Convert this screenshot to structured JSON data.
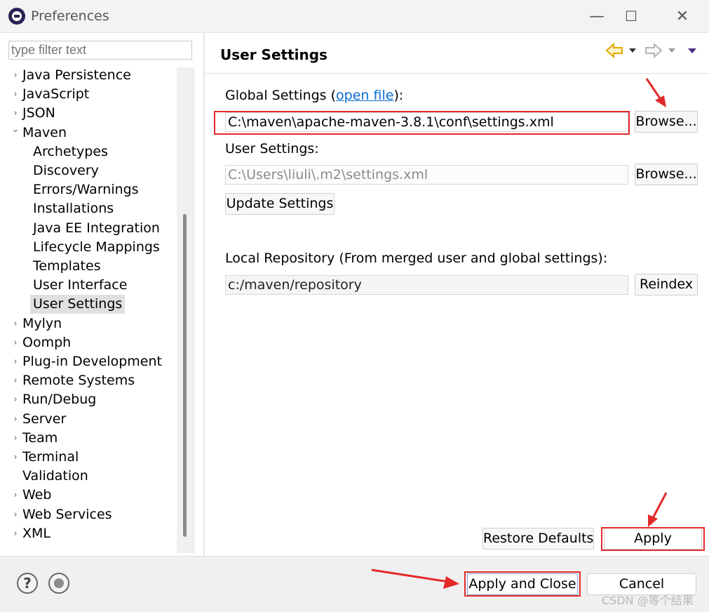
{
  "window": {
    "title": "Preferences",
    "minimize": "—",
    "maximize": "☐",
    "close": "✕"
  },
  "filter": {
    "placeholder": "type filter text"
  },
  "tree": {
    "items": [
      {
        "label": "Java Persistence",
        "expandable": true,
        "expanded": false,
        "indent": 0,
        "selected": false
      },
      {
        "label": "JavaScript",
        "expandable": true,
        "expanded": false,
        "indent": 0,
        "selected": false
      },
      {
        "label": "JSON",
        "expandable": true,
        "expanded": false,
        "indent": 0,
        "selected": false
      },
      {
        "label": "Maven",
        "expandable": true,
        "expanded": true,
        "indent": 0,
        "selected": false
      },
      {
        "label": "Archetypes",
        "expandable": false,
        "expanded": false,
        "indent": 1,
        "selected": false
      },
      {
        "label": "Discovery",
        "expandable": false,
        "expanded": false,
        "indent": 1,
        "selected": false
      },
      {
        "label": "Errors/Warnings",
        "expandable": false,
        "expanded": false,
        "indent": 1,
        "selected": false
      },
      {
        "label": "Installations",
        "expandable": false,
        "expanded": false,
        "indent": 1,
        "selected": false
      },
      {
        "label": "Java EE Integration",
        "expandable": false,
        "expanded": false,
        "indent": 1,
        "selected": false
      },
      {
        "label": "Lifecycle Mappings",
        "expandable": false,
        "expanded": false,
        "indent": 1,
        "selected": false
      },
      {
        "label": "Templates",
        "expandable": false,
        "expanded": false,
        "indent": 1,
        "selected": false
      },
      {
        "label": "User Interface",
        "expandable": false,
        "expanded": false,
        "indent": 1,
        "selected": false
      },
      {
        "label": "User Settings",
        "expandable": false,
        "expanded": false,
        "indent": 1,
        "selected": true
      },
      {
        "label": "Mylyn",
        "expandable": true,
        "expanded": false,
        "indent": 0,
        "selected": false
      },
      {
        "label": "Oomph",
        "expandable": true,
        "expanded": false,
        "indent": 0,
        "selected": false
      },
      {
        "label": "Plug-in Development",
        "expandable": true,
        "expanded": false,
        "indent": 0,
        "selected": false
      },
      {
        "label": "Remote Systems",
        "expandable": true,
        "expanded": false,
        "indent": 0,
        "selected": false
      },
      {
        "label": "Run/Debug",
        "expandable": true,
        "expanded": false,
        "indent": 0,
        "selected": false
      },
      {
        "label": "Server",
        "expandable": true,
        "expanded": false,
        "indent": 0,
        "selected": false
      },
      {
        "label": "Team",
        "expandable": true,
        "expanded": false,
        "indent": 0,
        "selected": false
      },
      {
        "label": "Terminal",
        "expandable": true,
        "expanded": false,
        "indent": 0,
        "selected": false
      },
      {
        "label": "Validation",
        "expandable": false,
        "expanded": false,
        "indent": 0,
        "selected": false
      },
      {
        "label": "Web",
        "expandable": true,
        "expanded": false,
        "indent": 0,
        "selected": false
      },
      {
        "label": "Web Services",
        "expandable": true,
        "expanded": false,
        "indent": 0,
        "selected": false
      },
      {
        "label": "XML",
        "expandable": true,
        "expanded": false,
        "indent": 0,
        "selected": false
      }
    ]
  },
  "page": {
    "title": "User Settings",
    "global": {
      "label_prefix": "Global Settings (",
      "link": "open file",
      "label_suffix": "):",
      "value": "C:\\maven\\apache-maven-3.8.1\\conf\\settings.xml",
      "browse": "Browse..."
    },
    "user": {
      "label": "User Settings:",
      "value": "C:\\Users\\liuli\\.m2\\settings.xml",
      "browse": "Browse..."
    },
    "update_button": "Update Settings",
    "local_repo": {
      "label": "Local Repository (From merged user and global settings):",
      "value": "c:/maven/repository",
      "reindex": "Reindex"
    },
    "restore_defaults": "Restore Defaults",
    "apply": "Apply"
  },
  "footer": {
    "help_icon": "?",
    "apply_and_close": "Apply and Close",
    "cancel": "Cancel"
  },
  "watermark": "CSDN @等个结果",
  "colors": {
    "annotation_red": "#e32a2a",
    "link_blue": "#0b6bd0",
    "back_arrow_yellow": "#e0a800",
    "menu_purple": "#4b2a86"
  }
}
